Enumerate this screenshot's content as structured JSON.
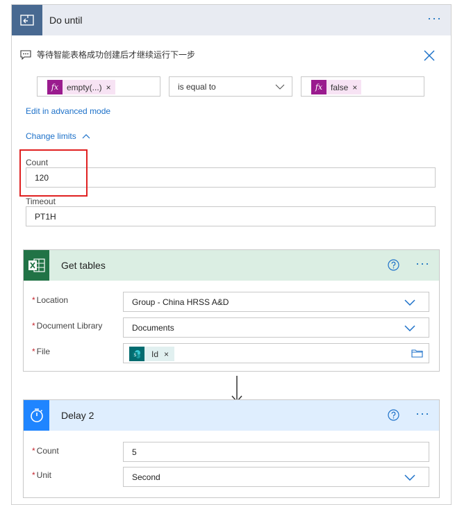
{
  "do_until": {
    "title": "Do until",
    "comment": "等待智能表格成功创建后才继续运行下一步",
    "condition": {
      "left_token": "empty(...)",
      "operator": "is equal to",
      "right_token": "false"
    },
    "edit_advanced_label": "Edit in advanced mode",
    "change_limits_label": "Change limits",
    "count_label": "Count",
    "count_value": "120",
    "timeout_label": "Timeout",
    "timeout_value": "PT1H"
  },
  "get_tables": {
    "title": "Get tables",
    "accent": "#217346",
    "header_bg": "#dbeee3",
    "location_label": "Location",
    "location_value": "Group - China HRSS A&D",
    "library_label": "Document Library",
    "library_value": "Documents",
    "file_label": "File",
    "file_token": "Id"
  },
  "delay": {
    "title": "Delay 2",
    "accent": "#1f85ff",
    "header_bg": "#dfeefe",
    "count_label": "Count",
    "count_value": "5",
    "unit_label": "Unit",
    "unit_value": "Second"
  },
  "icons": {
    "loop": "loop-icon",
    "comment": "comment-icon",
    "close": "close-icon",
    "fx": "fx-icon",
    "excel": "excel-icon",
    "sharepoint": "sharepoint-icon",
    "timer": "timer-icon",
    "help": "help-icon",
    "folder": "folder-icon",
    "chevron": "chevron-down-icon"
  },
  "fx_symbol": "fx",
  "required_mark": "*",
  "token_remove": "×"
}
